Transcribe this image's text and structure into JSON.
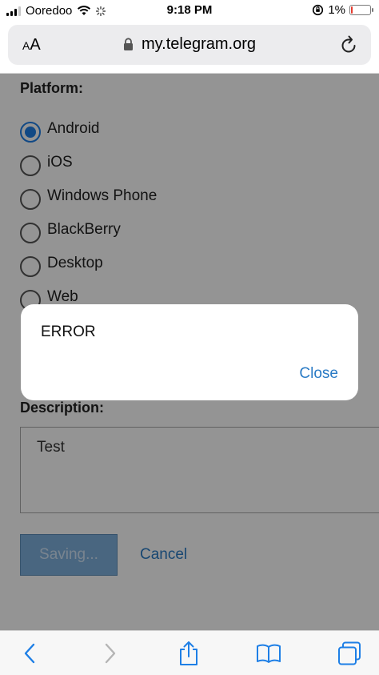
{
  "status_bar": {
    "carrier": "Ooredoo",
    "time": "9:18 PM",
    "battery": "1%"
  },
  "address_bar": {
    "aa_label_small": "A",
    "aa_label_large": "A",
    "url": "my.telegram.org"
  },
  "form": {
    "platform_label": "Platform:",
    "platforms": [
      {
        "label": "Android",
        "selected": true
      },
      {
        "label": "iOS",
        "selected": false
      },
      {
        "label": "Windows Phone",
        "selected": false
      },
      {
        "label": "BlackBerry",
        "selected": false
      },
      {
        "label": "Desktop",
        "selected": false
      },
      {
        "label": "Web",
        "selected": false
      }
    ],
    "description_label": "Description:",
    "description_value": "Test",
    "save_label": "Saving...",
    "cancel_label": "Cancel"
  },
  "dialog": {
    "message": "ERROR",
    "close_label": "Close"
  },
  "colors": {
    "accent": "#1e7fe6",
    "link": "#2a7bc5"
  }
}
